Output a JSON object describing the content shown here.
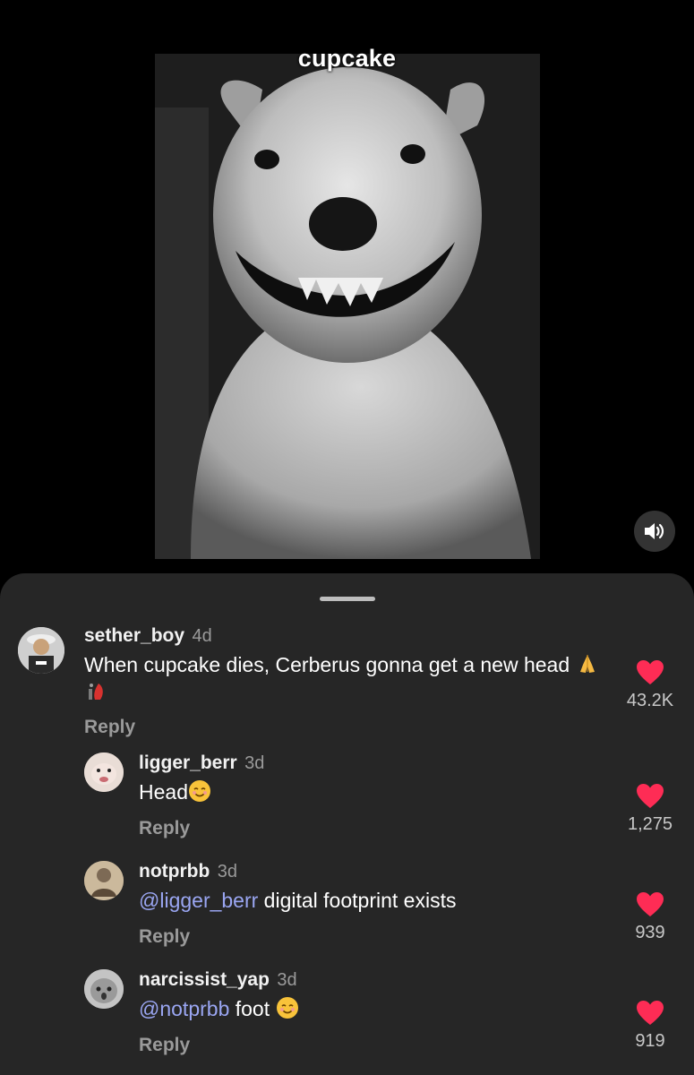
{
  "video": {
    "caption": "cupcake",
    "sound_icon": "speaker-volume-icon"
  },
  "comments": [
    {
      "username": "sether_boy",
      "time": "4d",
      "text": "When cupcake dies, Cerberus gonna get a new head",
      "emojis": [
        "folded-hands-emoji",
        "dog-fire-emoji"
      ],
      "reply_label": "Reply",
      "likes": "43.2K"
    },
    {
      "username": "ligger_berr",
      "time": "3d",
      "text": "Head",
      "emojis": [
        "smiling-face-emoji"
      ],
      "reply_label": "Reply",
      "likes": "1,275"
    },
    {
      "username": "notprbb",
      "time": "3d",
      "mention": "@ligger_berr",
      "text": " digital footprint exists",
      "reply_label": "Reply",
      "likes": "939"
    },
    {
      "username": "narcissist_yap",
      "time": "3d",
      "mention": "@notprbb",
      "text": " foot ",
      "emojis": [
        "smiling-face-emoji"
      ],
      "reply_label": "Reply",
      "likes": "919"
    }
  ],
  "colors": {
    "heart": "#fe2c55",
    "mention": "#9aa6f2",
    "sheet_bg": "#262626"
  }
}
